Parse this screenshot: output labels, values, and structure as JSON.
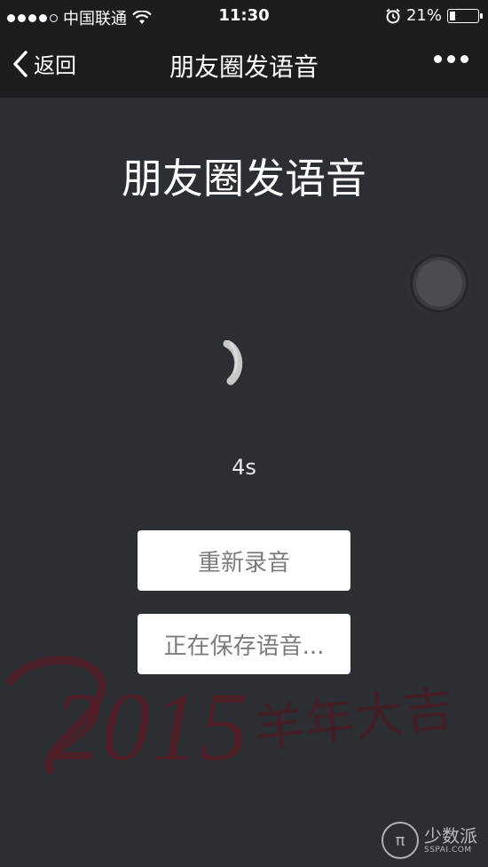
{
  "status_bar": {
    "carrier": "中国联通",
    "time": "11:30",
    "battery_percent": "21%",
    "battery_level": 0.21,
    "signal_dots_filled": 4,
    "icons": [
      "signal-dots-icon",
      "wifi-icon",
      "alarm-icon",
      "battery-icon"
    ]
  },
  "navbar": {
    "back_label": "返回",
    "title": "朋友圈发语音",
    "more_icon": "more-dots-icon"
  },
  "main": {
    "heading": "朋友圈发语音",
    "duration": "4s",
    "buttons": {
      "rerecord": "重新录音",
      "saving": "正在保存语音..."
    }
  },
  "watermark": {
    "year": "2015",
    "greeting": "羊年大吉"
  },
  "brand": {
    "name_cn": "少数派",
    "name_en": "SSPAI.COM"
  },
  "colors": {
    "background": "#2b2e33",
    "bar": "#1c1d21",
    "button_bg": "#ffffff",
    "button_text": "#7c7c7c",
    "watermark": "#6b1f2a"
  }
}
